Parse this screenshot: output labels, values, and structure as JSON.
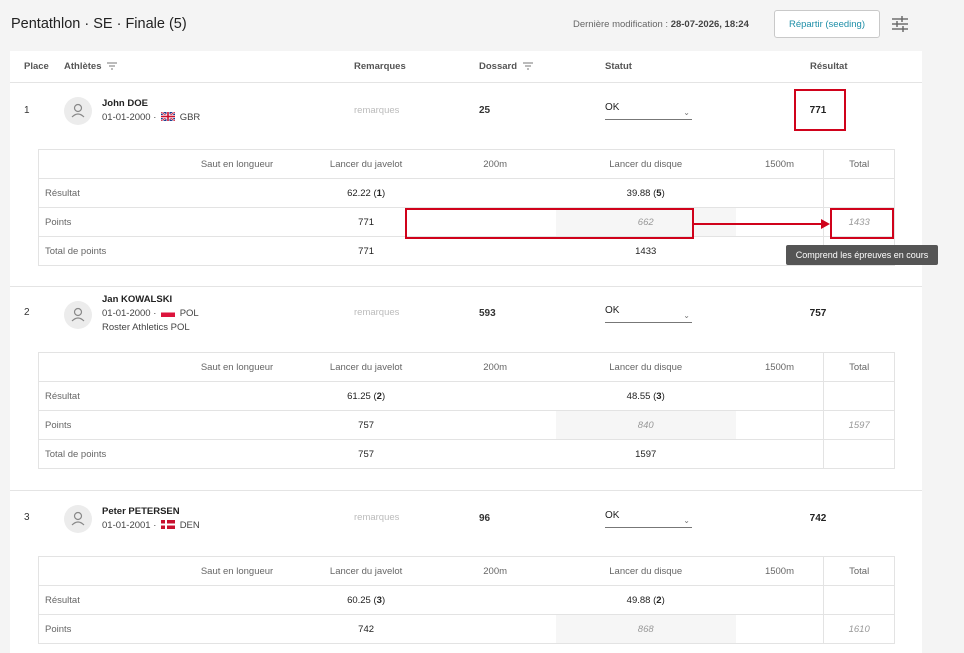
{
  "header": {
    "title": "Pentathlon · SE · Finale (5)",
    "last_mod_label": "Dernière modification :",
    "last_mod_value": "28-07-2026, 18:24",
    "seed_button": "Répartir (seeding)",
    "settings_icon": "sliders-icon"
  },
  "columns": {
    "place": "Place",
    "athletes": "Athlètes",
    "remarks": "Remarques",
    "bib": "Dossard",
    "status": "Statut",
    "result": "Résultat"
  },
  "events": {
    "label_col": "",
    "e1": "Saut en longueur",
    "e2": "Lancer du javelot",
    "e3": "200m",
    "e4": "Lancer du disque",
    "e5": "1500m",
    "total": "Total"
  },
  "row_labels": {
    "result": "Résultat",
    "points": "Points",
    "total_points": "Total de points"
  },
  "athletes": [
    {
      "place": "1",
      "name": "John DOE",
      "dob": "01-01-2000 ·",
      "country": "GBR",
      "club": "",
      "remarks": "remarques",
      "bib": "25",
      "status": "OK",
      "result": "771",
      "javelin_result": "62.22",
      "javelin_rank": "1",
      "discus_result": "39.88",
      "discus_rank": "5",
      "javelin_points": "771",
      "discus_points": "662",
      "total": "1433",
      "javelin_total": "771",
      "discus_total": "1433"
    },
    {
      "place": "2",
      "name": "Jan KOWALSKI",
      "dob": "01-01-2000 ·",
      "country": "POL",
      "club": "Roster Athletics POL",
      "remarks": "remarques",
      "bib": "593",
      "status": "OK",
      "result": "757",
      "javelin_result": "61.25",
      "javelin_rank": "2",
      "discus_result": "48.55",
      "discus_rank": "3",
      "javelin_points": "757",
      "discus_points": "840",
      "total": "1597",
      "javelin_total": "757",
      "discus_total": "1597"
    },
    {
      "place": "3",
      "name": "Peter PETERSEN",
      "dob": "01-01-2001 ·",
      "country": "DEN",
      "club": "",
      "remarks": "remarques",
      "bib": "96",
      "status": "OK",
      "result": "742",
      "javelin_result": "60.25",
      "javelin_rank": "3",
      "discus_result": "49.88",
      "discus_rank": "2",
      "javelin_points": "742",
      "discus_points": "868",
      "total": "1610"
    }
  ],
  "tooltip": "Comprend les épreuves en cours",
  "colors": {
    "accent": "#1f8fa8",
    "highlight": "#d0021b"
  }
}
